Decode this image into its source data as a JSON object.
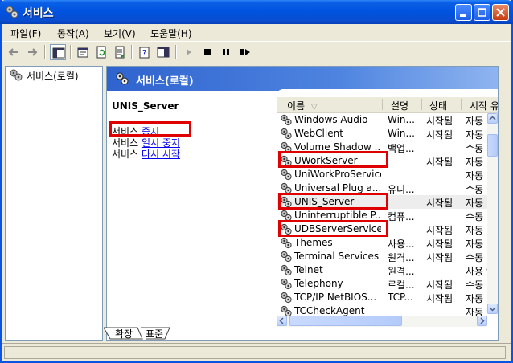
{
  "window": {
    "title": "서비스"
  },
  "menu": [
    {
      "label": "파일(F)"
    },
    {
      "label": "동작(A)"
    },
    {
      "label": "보기(V)"
    },
    {
      "label": "도움말(H)"
    }
  ],
  "tree": {
    "root_label": "서비스(로컬)"
  },
  "pane": {
    "header": "서비스(로컬)"
  },
  "extended": {
    "service_name": "UNIS_Server",
    "stop_prefix": "서비스 ",
    "stop_link": "중지",
    "pause_prefix": "서비스 ",
    "pause_link": "일시 중지",
    "restart_prefix": "서비스 ",
    "restart_link": "다시 시작"
  },
  "table": {
    "columns": [
      "이름",
      "설명",
      "상태",
      "시작 유"
    ],
    "sort_indicator": "▽",
    "rows": [
      {
        "name": "Windows Audio",
        "desc": "Win...",
        "status": "시작됨",
        "start": "자동"
      },
      {
        "name": "WebClient",
        "desc": "Win...",
        "status": "시작됨",
        "start": "자동"
      },
      {
        "name": "Volume Shadow ...",
        "desc": "백업...",
        "status": "",
        "start": "수동"
      },
      {
        "name": "UWorkServer",
        "desc": "",
        "status": "시작됨",
        "start": "자동"
      },
      {
        "name": "UniWorkProService",
        "desc": "",
        "status": "",
        "start": "자동"
      },
      {
        "name": "Universal Plug a...",
        "desc": "유니...",
        "status": "",
        "start": "수동"
      },
      {
        "name": "UNIS_Server",
        "desc": "",
        "status": "시작됨",
        "start": "자동"
      },
      {
        "name": "Uninterruptible P...",
        "desc": "컴퓨...",
        "status": "",
        "start": "수동"
      },
      {
        "name": "UDBServerService",
        "desc": "",
        "status": "시작됨",
        "start": "자동"
      },
      {
        "name": "Themes",
        "desc": "사용...",
        "status": "시작됨",
        "start": "자동"
      },
      {
        "name": "Terminal Services",
        "desc": "원격...",
        "status": "시작됨",
        "start": "수동"
      },
      {
        "name": "Telnet",
        "desc": "원격...",
        "status": "",
        "start": "사용 안"
      },
      {
        "name": "Telephony",
        "desc": "로컬...",
        "status": "시작됨",
        "start": "수동"
      },
      {
        "name": "TCP/IP NetBIOS...",
        "desc": "TCP...",
        "status": "시작됨",
        "start": "자동"
      },
      {
        "name": "TCCheckAgent",
        "desc": "",
        "status": "",
        "start": "자동"
      }
    ]
  },
  "tabs": [
    {
      "label": "확장"
    },
    {
      "label": "표준"
    }
  ],
  "colors": {
    "titlebar": "#0054E3",
    "highlight_box": "#E00000",
    "link": "#0000EE",
    "selected_row": "#EDEDED"
  }
}
